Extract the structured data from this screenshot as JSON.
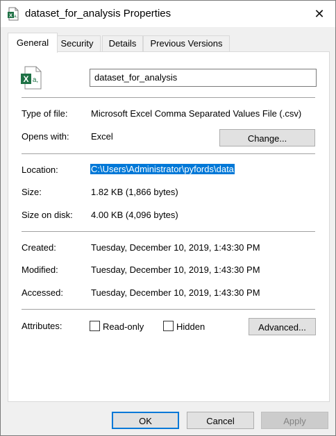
{
  "window": {
    "title": "dataset_for_analysis Properties",
    "close_glyph": "✕"
  },
  "tabs": [
    {
      "label": "General",
      "active": true
    },
    {
      "label": "Security"
    },
    {
      "label": "Details"
    },
    {
      "label": "Previous Versions"
    }
  ],
  "file": {
    "name": "dataset_for_analysis",
    "icon": "excel-csv-icon"
  },
  "info": {
    "type_label": "Type of file:",
    "type_value": "Microsoft Excel Comma Separated Values File (.csv)",
    "opens_label": "Opens with:",
    "opens_value": "Excel",
    "change_label": "Change...",
    "location_label": "Location:",
    "location_value": "C:\\Users\\Administrator\\pyfords\\data",
    "size_label": "Size:",
    "size_value": "1.82 KB (1,866 bytes)",
    "disk_label": "Size on disk:",
    "disk_value": "4.00 KB (4,096 bytes)",
    "created_label": "Created:",
    "created_value": "Tuesday, December 10, 2019, 1:43:30 PM",
    "modified_label": "Modified:",
    "modified_value": "Tuesday, December 10, 2019, 1:43:30 PM",
    "accessed_label": "Accessed:",
    "accessed_value": "Tuesday, December 10, 2019, 1:43:30 PM"
  },
  "attributes": {
    "label": "Attributes:",
    "readonly_label": "Read-only",
    "readonly_checked": false,
    "hidden_label": "Hidden",
    "hidden_checked": false,
    "advanced_label": "Advanced..."
  },
  "footer": {
    "ok": "OK",
    "cancel": "Cancel",
    "apply": "Apply"
  },
  "colors": {
    "selection": "#0078d7",
    "excel_green": "#1e7145"
  }
}
